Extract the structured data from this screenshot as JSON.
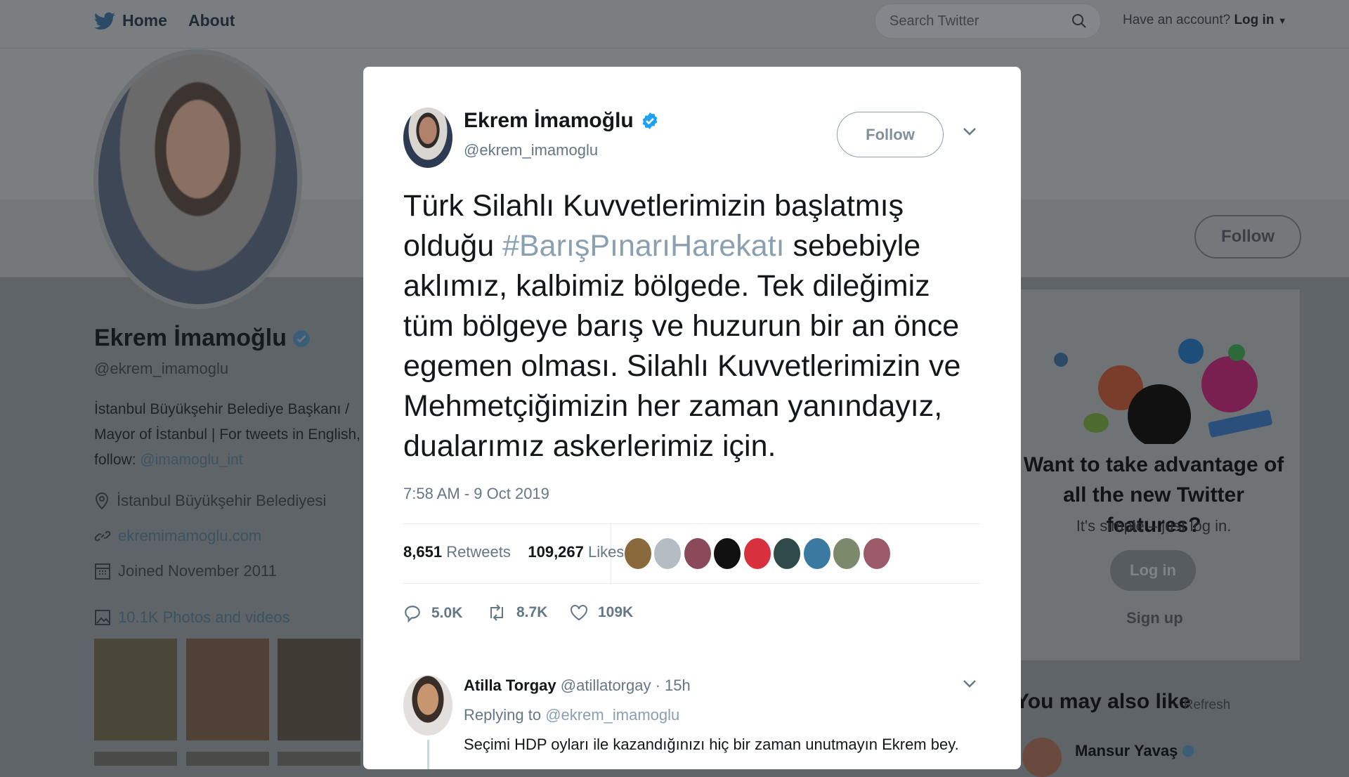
{
  "nav": {
    "home": "Home",
    "about": "About",
    "search_placeholder": "Search Twitter",
    "have_account": "Have an account?",
    "login": "Log in"
  },
  "background": {
    "follow": "Follow",
    "profile_name": "Ekrem İmamoğlu",
    "profile_handle": "@ekrem_imamoglu",
    "bio_line1": "İstanbul Büyükşehir Belediye Başkanı /",
    "bio_line2": "Mayor of İstanbul | For tweets in English,",
    "bio_line3_prefix": "follow: ",
    "bio_link": "@imamoglu_int",
    "location": "İstanbul Büyükşehir Belediyesi",
    "website": "ekremimamoglu.com",
    "joined": "Joined November 2011",
    "photos": "10.1K Photos and videos",
    "right_title": "Want to take advantage of all the new Twitter features?",
    "right_sub": "It's simple – just log in.",
    "right_login": "Log in",
    "right_signup": "Sign up",
    "also_like": "You may also like",
    "refresh": "· Refresh",
    "suggested_name": "Mansur Yavaş"
  },
  "tweet": {
    "name": "Ekrem İmamoğlu",
    "handle": "@ekrem_imamoglu",
    "follow": "Follow",
    "text_before": "Türk Silahlı Kuvvetlerimizin başlatmış olduğu ",
    "hashtag": "#BarışPınarıHarekatı",
    "text_after": " sebebiyle aklımız, kalbimiz bölgede. Tek dileğimiz tüm bölgeye barış ve huzurun bir an önce egemen olması. Silahlı Kuvvetlerimizin ve Mehmetçiğimizin her zaman yanındayız, dualarımız askerlerimiz için.",
    "timestamp": "7:58 AM - 9 Oct 2019",
    "retweets_count": "8,651",
    "retweets_label": "Retweets",
    "likes_count": "109,267",
    "likes_label": "Likes",
    "reply_count": "5.0K",
    "retweet_count_short": "8.7K",
    "like_count_short": "109K"
  },
  "reply": {
    "name": "Atilla Torgay",
    "handle_time": "@atillatorgay · 15h",
    "replying_prefix": "Replying to ",
    "replying_to": "@ekrem_imamoglu",
    "text": "Seçimi HDP oyları ile kazandığınızı hiç bir zaman unutmayın Ekrem bey."
  },
  "colors": {
    "twitter_blue": "#1da1f2",
    "verified": "#1da1f2",
    "link_muted": "#8aa0b0",
    "text_gray": "#657786"
  }
}
